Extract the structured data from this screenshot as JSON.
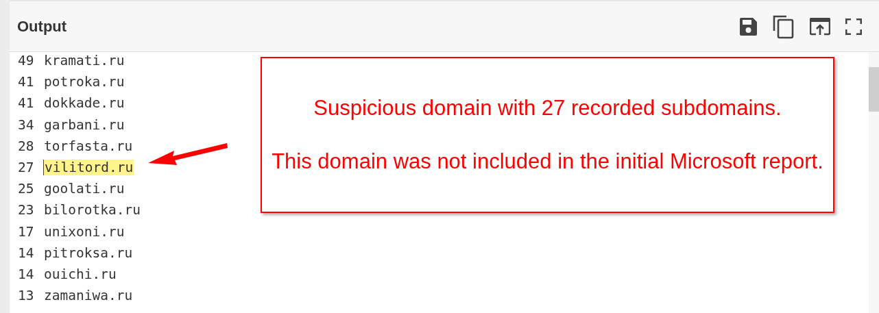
{
  "panel": {
    "title": "Output"
  },
  "rows": [
    {
      "count": "49",
      "domain": "kramati.ru",
      "highlighted": false
    },
    {
      "count": "41",
      "domain": "potroka.ru",
      "highlighted": false
    },
    {
      "count": "41",
      "domain": "dokkade.ru",
      "highlighted": false
    },
    {
      "count": "34",
      "domain": "garbani.ru",
      "highlighted": false
    },
    {
      "count": "28",
      "domain": "torfasta.ru",
      "highlighted": false
    },
    {
      "count": "27",
      "domain": "vilitord.ru",
      "highlighted": true
    },
    {
      "count": "25",
      "domain": "goolati.ru",
      "highlighted": false
    },
    {
      "count": "23",
      "domain": "bilorotka.ru",
      "highlighted": false
    },
    {
      "count": "17",
      "domain": "unixoni.ru",
      "highlighted": false
    },
    {
      "count": "14",
      "domain": "pitroksa.ru",
      "highlighted": false
    },
    {
      "count": "14",
      "domain": "ouichi.ru",
      "highlighted": false
    },
    {
      "count": "13",
      "domain": "zamaniwa.ru",
      "highlighted": false
    }
  ],
  "callout": {
    "lines": [
      "Suspicious domain with 27 recorded subdomains.",
      "This domain was not included in the initial Microsoft report."
    ]
  }
}
